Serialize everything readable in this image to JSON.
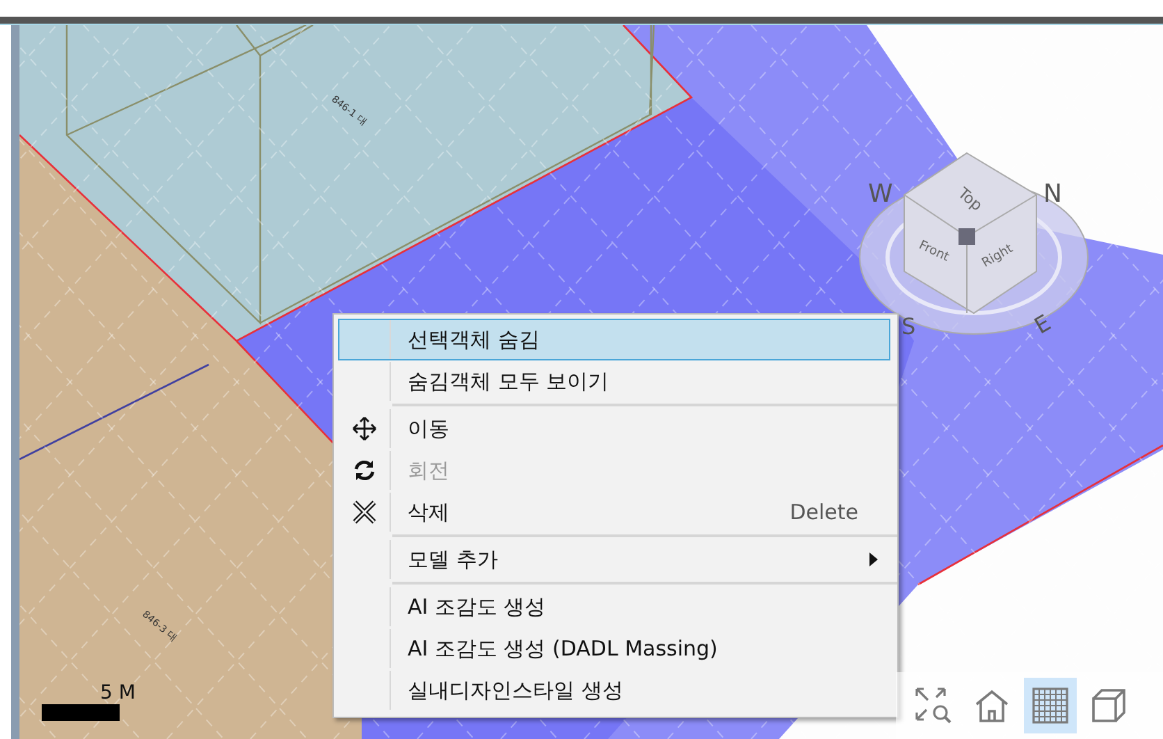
{
  "viewport": {
    "parcel_labels": [
      {
        "text": "846-1 대"
      },
      {
        "text": "846-3 대"
      }
    ],
    "view_cube": {
      "faces": [
        "Top",
        "Front",
        "Right"
      ],
      "compass": [
        "W",
        "N",
        "S",
        "E"
      ]
    },
    "scale_bar": {
      "label": "5 M"
    }
  },
  "context_menu": {
    "items": [
      {
        "kind": "plain",
        "label": "선택객체 숨김",
        "selected": true,
        "disabled": false
      },
      {
        "kind": "plain",
        "label": "숨김객체 모두 보이기",
        "selected": false,
        "disabled": false
      },
      {
        "kind": "separator"
      },
      {
        "kind": "move",
        "label": "이동",
        "selected": false,
        "disabled": false
      },
      {
        "kind": "rotate",
        "label": "회전",
        "selected": false,
        "disabled": true
      },
      {
        "kind": "delete",
        "label": "삭제",
        "shortcut": "Delete",
        "selected": false,
        "disabled": false
      },
      {
        "kind": "separator"
      },
      {
        "kind": "submenu",
        "label": "모델 추가",
        "selected": false,
        "disabled": false
      },
      {
        "kind": "separator"
      },
      {
        "kind": "plain",
        "label": "AI 조감도 생성",
        "selected": false,
        "disabled": false
      },
      {
        "kind": "plain",
        "label": "AI 조감도 생성 (DADL Massing)",
        "selected": false,
        "disabled": false
      },
      {
        "kind": "plain",
        "label": "실내디자인스타일 생성",
        "selected": false,
        "disabled": false
      }
    ]
  },
  "toolbar": [
    {
      "kind": "zoom-extents",
      "selected": false
    },
    {
      "kind": "home",
      "selected": false
    },
    {
      "kind": "grid",
      "selected": true
    },
    {
      "kind": "box",
      "selected": false
    }
  ]
}
